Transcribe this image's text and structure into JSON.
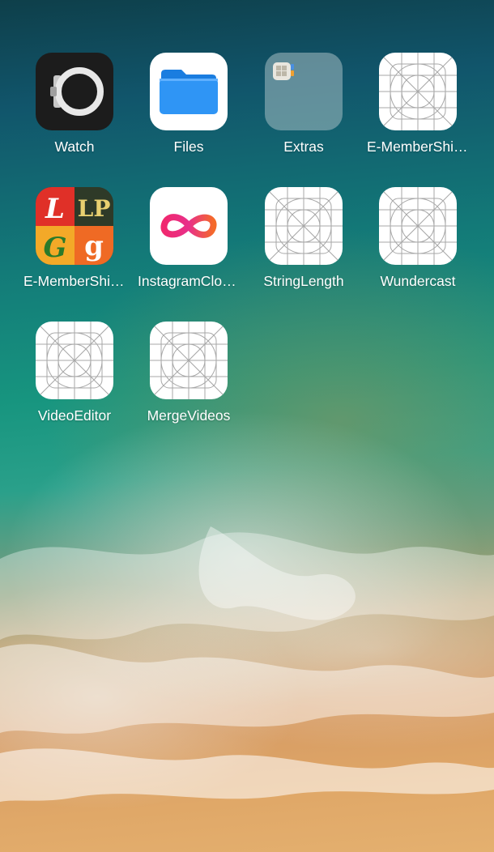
{
  "screen": {
    "wallpaper": "ocean-beach-aerial",
    "colors": {
      "deep_water": "#11556b",
      "teal_water": "#17957f",
      "sand": "#e0a868",
      "label": "#ffffff"
    }
  },
  "apps": [
    {
      "label": "Watch",
      "icon": "watch-app-icon"
    },
    {
      "label": "Files",
      "icon": "files-app-icon"
    },
    {
      "label": "Extras",
      "icon": "folder-icon"
    },
    {
      "label": "E-MemberShip...",
      "icon": "placeholder-app-icon"
    },
    {
      "label": "E-MemberShip...",
      "icon": "lgp-logo-app-icon"
    },
    {
      "label": "InstagramClon...",
      "icon": "infinity-app-icon"
    },
    {
      "label": "StringLength",
      "icon": "placeholder-app-icon"
    },
    {
      "label": "Wundercast",
      "icon": "placeholder-app-icon"
    },
    {
      "label": "VideoEditor",
      "icon": "placeholder-app-icon"
    },
    {
      "label": "MergeVideos",
      "icon": "placeholder-app-icon"
    }
  ],
  "lgp_logo": {
    "letters": [
      "L",
      "LP",
      "G",
      "g"
    ]
  }
}
